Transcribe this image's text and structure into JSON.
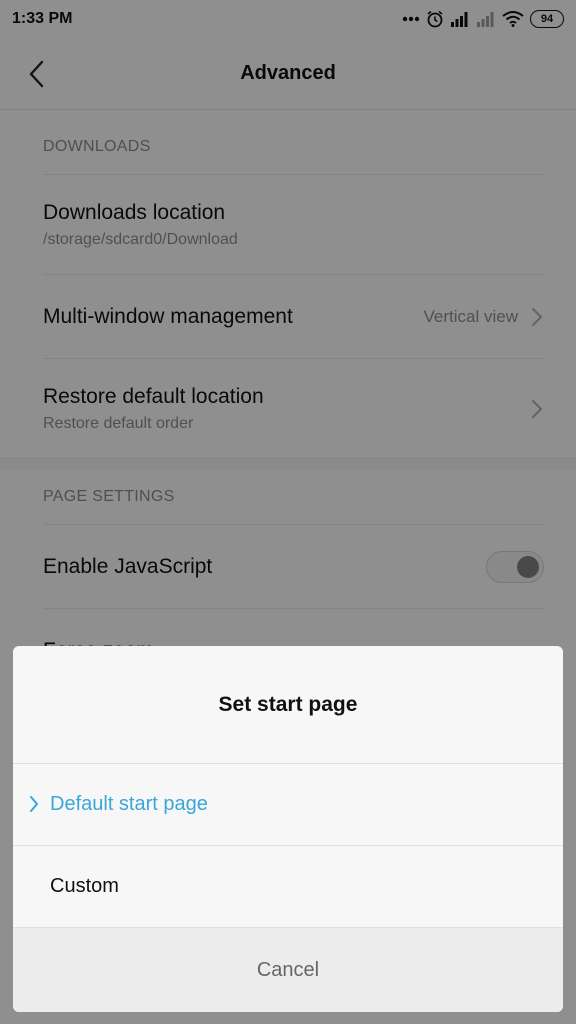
{
  "status_bar": {
    "time": "1:33 PM",
    "icons": [
      "more-dots-icon",
      "alarm-icon",
      "signal-icon",
      "signal-weak-icon",
      "wifi-icon"
    ],
    "battery": "94"
  },
  "header": {
    "back_icon": "back-arrow-icon",
    "title": "Advanced"
  },
  "sections": {
    "downloads": {
      "header": "DOWNLOADS",
      "downloads_location": {
        "title": "Downloads location",
        "subtitle": "/storage/sdcard0/Download"
      },
      "multi_window": {
        "title": "Multi-window management",
        "value": "Vertical view"
      },
      "restore_default": {
        "title": "Restore default location",
        "subtitle": "Restore default order"
      }
    },
    "page_settings": {
      "header": "PAGE SETTINGS",
      "enable_js": {
        "title": "Enable JavaScript",
        "enabled": true
      },
      "force_zoom": {
        "title": "Force zoom"
      }
    }
  },
  "dialog": {
    "title": "Set start page",
    "options": [
      {
        "label": "Default start page",
        "selected": true
      },
      {
        "label": "Custom",
        "selected": false
      }
    ],
    "cancel_label": "Cancel"
  },
  "colors": {
    "accent": "#3aa7d8",
    "overlay": "rgba(0,0,0,0.42)",
    "background": "#f7f7f7"
  }
}
